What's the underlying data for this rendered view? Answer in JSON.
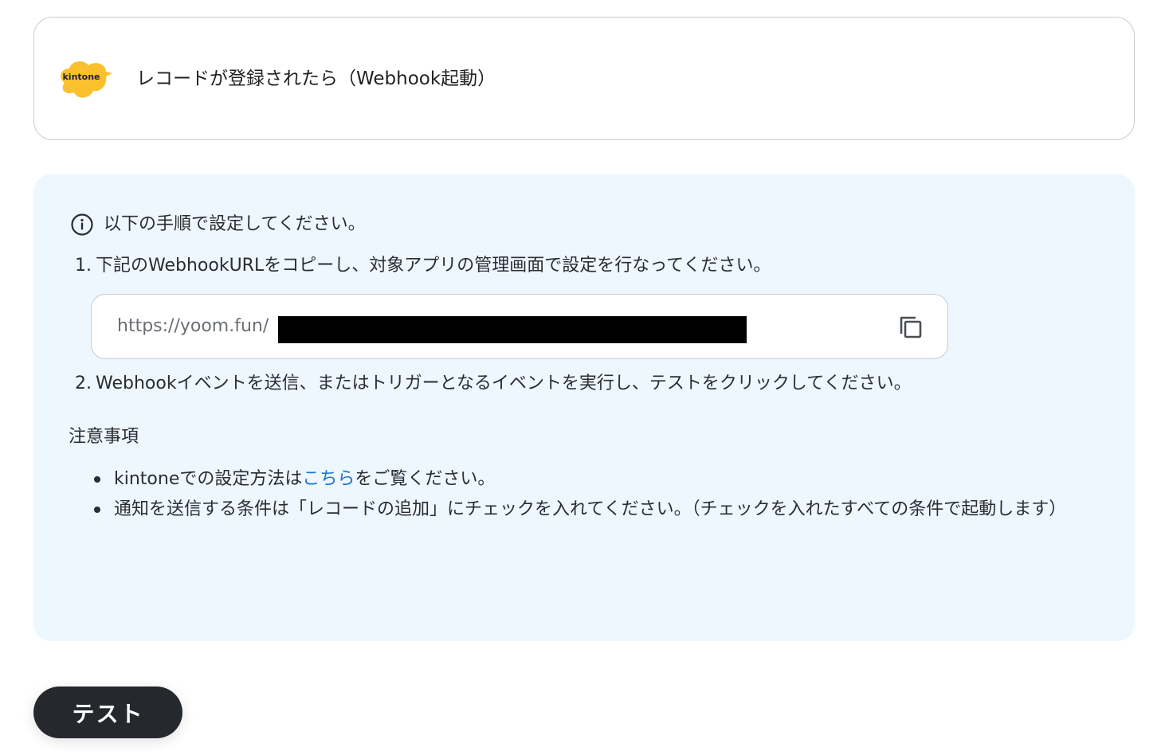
{
  "trigger": {
    "logo_text": "kintone",
    "title": "レコードが登録されたら（Webhook起動）"
  },
  "info": {
    "heading": "以下の手順で設定してください。",
    "step1_num": "1.",
    "step1_text": "下記のWebhookURLをコピーし、対象アプリの管理画面で設定を行なってください。",
    "url_visible": "https://yoom.fun/",
    "step2_num": "2.",
    "step2_text": "Webhookイベントを送信、またはトリガーとなるイベントを実行し、テストをクリックしてください。"
  },
  "notes": {
    "title": "注意事項",
    "item1_before": "kintoneでの設定方法は",
    "item1_link": "こちら",
    "item1_after": "をご覧ください。",
    "item2": "通知を送信する条件は「レコードの追加」にチェックを入れてください。（チェックを入れたすべての条件で起動します）"
  },
  "actions": {
    "test_label": "テスト"
  },
  "colors": {
    "panel_bg": "#eef6fe",
    "link": "#1a73d9",
    "button_bg": "#25292e",
    "kintone_yellow": "#fbc02d"
  }
}
